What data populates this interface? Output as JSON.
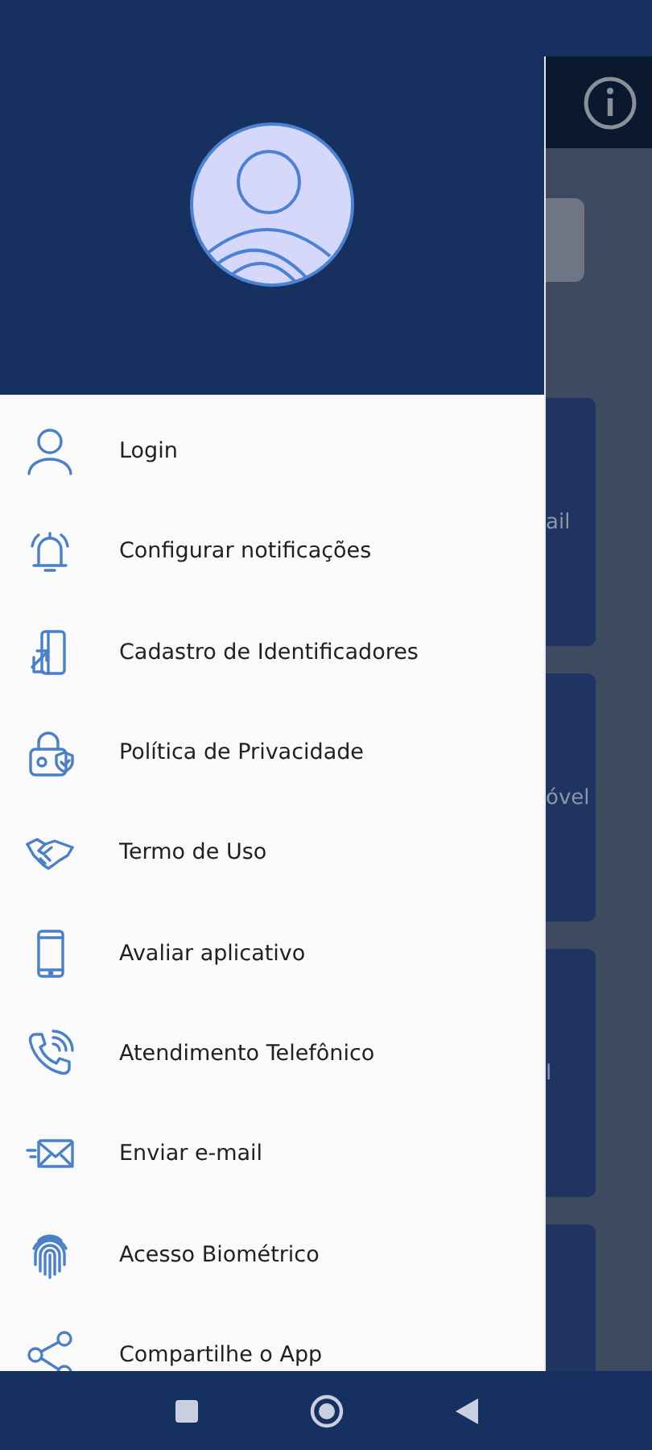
{
  "drawer": {
    "items": [
      {
        "label": "Login"
      },
      {
        "label": "Configurar notificações"
      },
      {
        "label": "Cadastro de Identificadores"
      },
      {
        "label": "Política de Privacidade"
      },
      {
        "label": "Termo de Uso"
      },
      {
        "label": "Avaliar aplicativo"
      },
      {
        "label": "Atendimento Telefônico"
      },
      {
        "label": "Enviar e-mail"
      },
      {
        "label": "Acesso Biométrico"
      },
      {
        "label": "Compartilhe o App"
      }
    ]
  },
  "background": {
    "cards": [
      {
        "label": "ail"
      },
      {
        "label": "óvel"
      },
      {
        "label": "l"
      }
    ]
  }
}
